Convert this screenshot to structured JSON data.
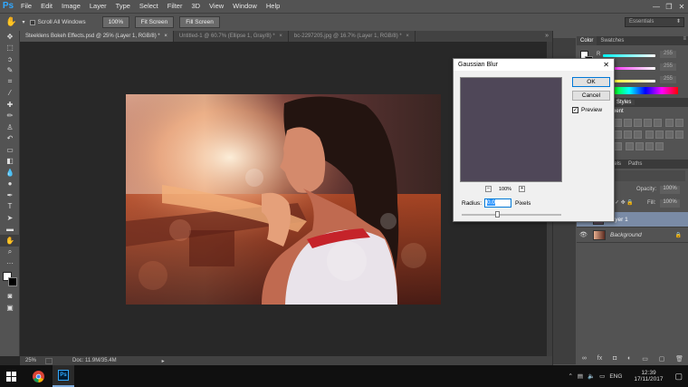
{
  "menubar": {
    "logo": "Ps",
    "items": [
      "File",
      "Edit",
      "Image",
      "Layer",
      "Type",
      "Select",
      "Filter",
      "3D",
      "View",
      "Window",
      "Help"
    ],
    "window_controls": [
      "—",
      "❐",
      "✕"
    ]
  },
  "options_bar": {
    "scroll_all_label": "Scroll All Windows",
    "btn_100": "100%",
    "btn_fit": "Fit Screen",
    "btn_fill": "Fill Screen",
    "workspace": "Essentials"
  },
  "tabs": [
    {
      "label": "Steeklens Bokeh Effects.psd @ 25% (Layer 1, RGB/8) *",
      "close": "×"
    },
    {
      "label": "Untitled-1 @ 60.7% (Ellipse 1, Gray/8) *",
      "close": "×"
    },
    {
      "label": "bc-2297205.jpg @ 16.7% (Layer 1, RGB/8) *",
      "close": "×"
    }
  ],
  "status": {
    "zoom": "25%",
    "doc": "Doc: 11.9M/35.4M"
  },
  "panels": {
    "color_tab": "Color",
    "swatches_tab": "Swatches",
    "slider_values": [
      "255",
      "255",
      "255"
    ],
    "channel_labels": [
      "R",
      "G",
      "B"
    ],
    "styles_tab": "Styles",
    "adjust_label": "nent",
    "paths_tab": "Paths",
    "channels_tab": "nels",
    "opacity_label": "Opacity:",
    "opacity_value": "100%",
    "fill_label": "Fill:",
    "fill_value": "100%",
    "layers": [
      {
        "name": "Layer 1",
        "selected": true
      },
      {
        "name": "Background",
        "selected": false
      }
    ]
  },
  "dialog": {
    "title": "Gaussian Blur",
    "close": "✕",
    "ok": "OK",
    "cancel": "Cancel",
    "preview_label": "Preview",
    "zoom": "100%",
    "zoom_minus": "−",
    "zoom_plus": "+",
    "radius_label": "Radius:",
    "radius_value": "0.0",
    "units": "Pixels",
    "radius_slider_fraction": 0.35
  },
  "taskbar": {
    "lang": "ENG",
    "time": "12:39",
    "date": "17/11/2017"
  },
  "colors": {
    "ui_dark": "#535353",
    "canvas_bg": "#282828",
    "accent_blue": "#31a8ff",
    "selected_layer": "#7a8ba6"
  }
}
